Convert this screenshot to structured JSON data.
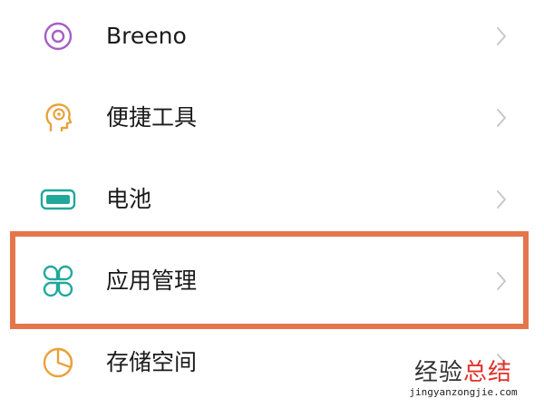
{
  "settings_list": {
    "items": [
      {
        "label": "Breeno",
        "icon": "breeno-icon",
        "icon_color": "#a65fc6"
      },
      {
        "label": "便捷工具",
        "icon": "head-bulb-icon",
        "icon_color": "#e9a23b"
      },
      {
        "label": "电池",
        "icon": "battery-icon",
        "icon_color": "#21a89b"
      },
      {
        "label": "应用管理",
        "icon": "app-grid-icon",
        "icon_color": "#21a89b"
      },
      {
        "label": "存储空间",
        "icon": "pie-chart-icon",
        "icon_color": "#e9a23b"
      }
    ],
    "chevron_icon": "chevron-right-icon",
    "highlighted_item": "应用管理",
    "highlight_color": "#e5754c"
  },
  "watermark": {
    "title_part1": "经验",
    "title_part2": "总结",
    "url": "jingyanzongjie.com",
    "accent_color": "#e0322b"
  }
}
